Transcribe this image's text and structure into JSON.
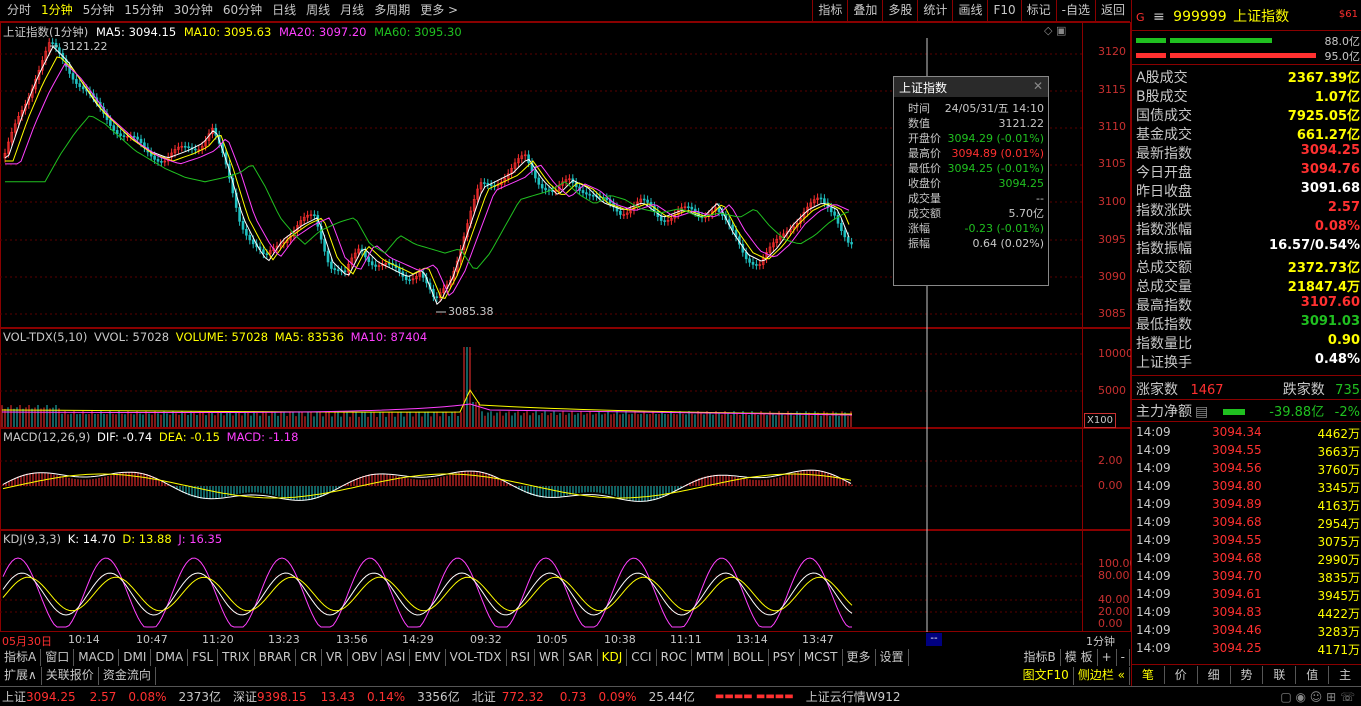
{
  "periods": [
    "分时",
    "1分钟",
    "5分钟",
    "15分钟",
    "30分钟",
    "60分钟",
    "日线",
    "周线",
    "月线",
    "多周期",
    "更多 >"
  ],
  "active_period": "1分钟",
  "tools": [
    "指标",
    "叠加",
    "多股",
    "统计",
    "画线",
    "F10",
    "标记",
    "-自选",
    "返回"
  ],
  "main_label": {
    "title": "上证指数(1分钟)",
    "ma5": "MA5: 3094.15",
    "ma10": "MA10: 3095.63",
    "ma20": "MA20: 3097.20",
    "ma60": "MA60: 3095.30"
  },
  "main_y_labels": [
    "3120",
    "3115",
    "3110",
    "3105",
    "3100",
    "3095",
    "3090",
    "3085"
  ],
  "hi_label": "3121.22",
  "lo_label": "3085.38",
  "vol_label": {
    "title": "VOL-TDX(5,10)",
    "vvol": "VVOL: 57028",
    "volume": "VOLUME: 57028",
    "ma5": "MA5: 83536",
    "ma10": "MA10: 87404"
  },
  "vol_y_labels": [
    "10000",
    "5000"
  ],
  "vol_unit": "X100",
  "macd_label": {
    "title": "MACD(12,26,9)",
    "dif": "DIF: -0.74",
    "dea": "DEA: -0.15",
    "macd": "MACD: -1.18"
  },
  "macd_y_labels": [
    "2.00",
    "0.00"
  ],
  "kdj_label": {
    "title": "KDJ(9,3,3)",
    "k": "K: 14.70",
    "d": "D: 13.88",
    "j": "J: 16.35"
  },
  "kdj_y_labels": [
    "100.00",
    "80.00",
    "40.00",
    "20.00",
    "0.00"
  ],
  "time_axis": [
    "05月30日",
    "10:14",
    "10:47",
    "11:20",
    "13:23",
    "13:56",
    "14:29",
    "09:32",
    "10:05",
    "10:38",
    "11:11",
    "13:14",
    "13:47"
  ],
  "time_axis_right": "1分钟",
  "tooltip": {
    "title": "上证指数",
    "rows": [
      {
        "k": "时间",
        "v": "24/05/31/五 14:10",
        "c": "#c8c8c8"
      },
      {
        "k": "数值",
        "v": "3121.22",
        "c": "#c8c8c8"
      },
      {
        "k": "开盘价",
        "v": "3094.29 (-0.01%)",
        "c": "#20c020"
      },
      {
        "k": "最高价",
        "v": "3094.89 (0.01%)",
        "c": "#ff3030"
      },
      {
        "k": "最低价",
        "v": "3094.25 (-0.01%)",
        "c": "#20c020"
      },
      {
        "k": "收盘价",
        "v": "3094.25",
        "c": "#20c020"
      },
      {
        "k": "成交量",
        "v": "--",
        "c": "#c8c8c8"
      },
      {
        "k": "成交额",
        "v": "5.70亿",
        "c": "#c8c8c8"
      },
      {
        "k": "涨幅",
        "v": "-0.23 (-0.01%)",
        "c": "#20c020"
      },
      {
        "k": "振幅",
        "v": "0.64 (0.02%)",
        "c": "#c8c8c8"
      }
    ]
  },
  "indicator_tabs": [
    "指标A",
    "窗口",
    "MACD",
    "DMI",
    "DMA",
    "FSL",
    "TRIX",
    "BRAR",
    "CR",
    "VR",
    "OBV",
    "ASI",
    "EMV",
    "VOL-TDX",
    "RSI",
    "WR",
    "SAR",
    "KDJ",
    "CCI",
    "ROC",
    "MTM",
    "BOLL",
    "PSY",
    "MCST",
    "更多",
    "设置"
  ],
  "indicator_right": [
    "指标B",
    "模 板",
    "+",
    "-"
  ],
  "bottom_tabs": [
    "扩展∧",
    "关联报价",
    "资金流向"
  ],
  "bottom_right": [
    "图文F10",
    "侧边栏 «"
  ],
  "side": {
    "code": "999999",
    "name": "上证指数",
    "badge": "$61",
    "bar_vals": [
      "88.0亿",
      "95.0亿"
    ],
    "rows": [
      {
        "k": "A股成交",
        "v": "2367.39亿",
        "c": "#ffff00"
      },
      {
        "k": "B股成交",
        "v": "1.07亿",
        "c": "#ffff00"
      },
      {
        "k": "国债成交",
        "v": "7925.05亿",
        "c": "#ffff00"
      },
      {
        "k": "基金成交",
        "v": "661.27亿",
        "c": "#ffff00"
      },
      {
        "k": "最新指数",
        "v": "3094.25",
        "c": "#ff3030"
      },
      {
        "k": "今日开盘",
        "v": "3094.76",
        "c": "#ff3030"
      },
      {
        "k": "昨日收盘",
        "v": "3091.68",
        "c": "#ffffff"
      },
      {
        "k": "指数涨跌",
        "v": "2.57",
        "c": "#ff3030"
      },
      {
        "k": "指数涨幅",
        "v": "0.08%",
        "c": "#ff3030"
      },
      {
        "k": "指数振幅",
        "v": "16.57/0.54%",
        "c": "#ffffff"
      },
      {
        "k": "总成交额",
        "v": "2372.73亿",
        "c": "#ffff00"
      },
      {
        "k": "总成交量",
        "v": "21847.4万",
        "c": "#ffff00"
      },
      {
        "k": "最高指数",
        "v": "3107.60",
        "c": "#ff3030"
      },
      {
        "k": "最低指数",
        "v": "3091.03",
        "c": "#20c020"
      },
      {
        "k": "指数量比",
        "v": "0.90",
        "c": "#ffff00"
      },
      {
        "k": "上证换手",
        "v": "0.48%",
        "c": "#ffffff"
      }
    ],
    "updown": {
      "up_label": "涨家数",
      "up": "1467",
      "down_label": "跌家数",
      "down": "735"
    },
    "net": {
      "label": "主力净额",
      "v": "-39.88亿",
      "pct": "-2%"
    },
    "ticks": [
      {
        "t": "14:09",
        "p": "3094.34",
        "v": "4462万"
      },
      {
        "t": "14:09",
        "p": "3094.55",
        "v": "3663万"
      },
      {
        "t": "14:09",
        "p": "3094.56",
        "v": "3760万"
      },
      {
        "t": "14:09",
        "p": "3094.80",
        "v": "3345万"
      },
      {
        "t": "14:09",
        "p": "3094.89",
        "v": "4163万"
      },
      {
        "t": "14:09",
        "p": "3094.68",
        "v": "2954万"
      },
      {
        "t": "14:09",
        "p": "3094.55",
        "v": "3075万"
      },
      {
        "t": "14:09",
        "p": "3094.68",
        "v": "2990万"
      },
      {
        "t": "14:09",
        "p": "3094.70",
        "v": "3835万"
      },
      {
        "t": "14:09",
        "p": "3094.61",
        "v": "3945万"
      },
      {
        "t": "14:09",
        "p": "3094.83",
        "v": "4422万"
      },
      {
        "t": "14:09",
        "p": "3094.46",
        "v": "3283万"
      },
      {
        "t": "14:09",
        "p": "3094.25",
        "v": "4171万"
      }
    ],
    "tabs": [
      "笔",
      "价",
      "细",
      "势",
      "联",
      "值",
      "主"
    ]
  },
  "status": {
    "sh_label": "上证",
    "sh_v": "3094.25",
    "sh_c": "2.57",
    "sh_p": "0.08%",
    "sh_amt": "2373亿",
    "sz_label": "深证",
    "sz_v": "9398.15",
    "sz_c": "13.43",
    "sz_p": "0.14%",
    "sz_amt": "3356亿",
    "bz_label": "北证",
    "bz_v": "772.32",
    "bz_c": "0.73",
    "bz_p": "0.09%",
    "bz_amt": "25.44亿",
    "news": "上证云行情W912"
  },
  "colors": {
    "up": "#ff3030",
    "down": "#20c0c0",
    "ma5": "#ffffff",
    "ma10": "#ffff00",
    "ma20": "#ff40ff",
    "ma60": "#20c020",
    "border": "#8a0000"
  }
}
